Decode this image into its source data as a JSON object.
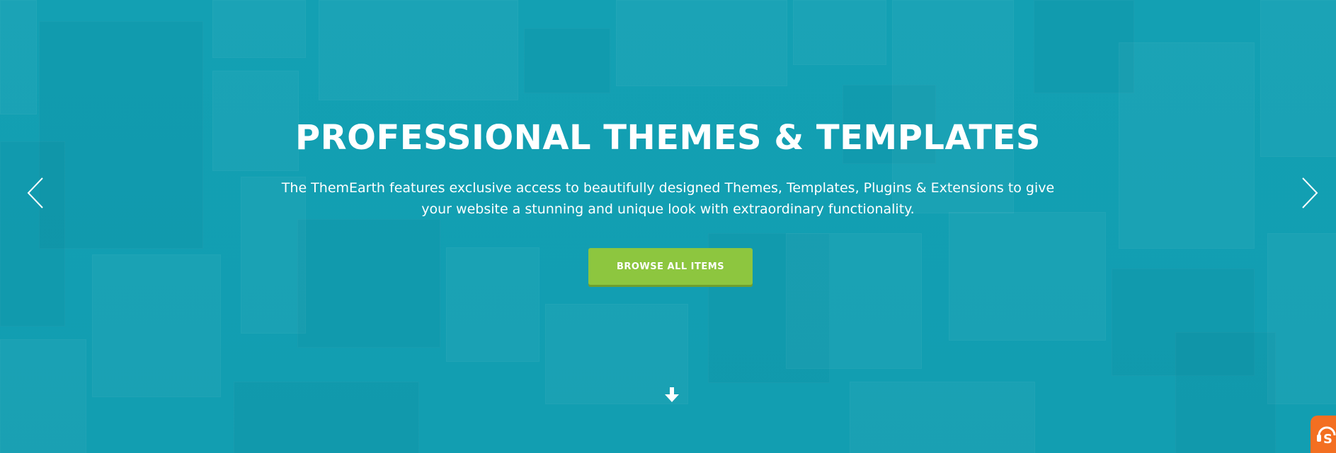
{
  "hero": {
    "title": "PROFESSIONAL THEMES & TEMPLATES",
    "subtitle": "The ThemEarth features exclusive access to beautifully designed Themes, Templates, Plugins & Extensions to give your website a stunning and unique look with extraordinary functionality.",
    "button_label": "BROWSE  ALL  ITEMS",
    "background_color": "#13a0b3",
    "button_color": "#8dc63f"
  },
  "controls": {
    "prev_icon": "chevron-left-icon",
    "next_icon": "chevron-right-icon",
    "scroll_icon": "arrow-down-icon",
    "support_icon": "support-headset-icon",
    "support_color": "#f36f21"
  }
}
